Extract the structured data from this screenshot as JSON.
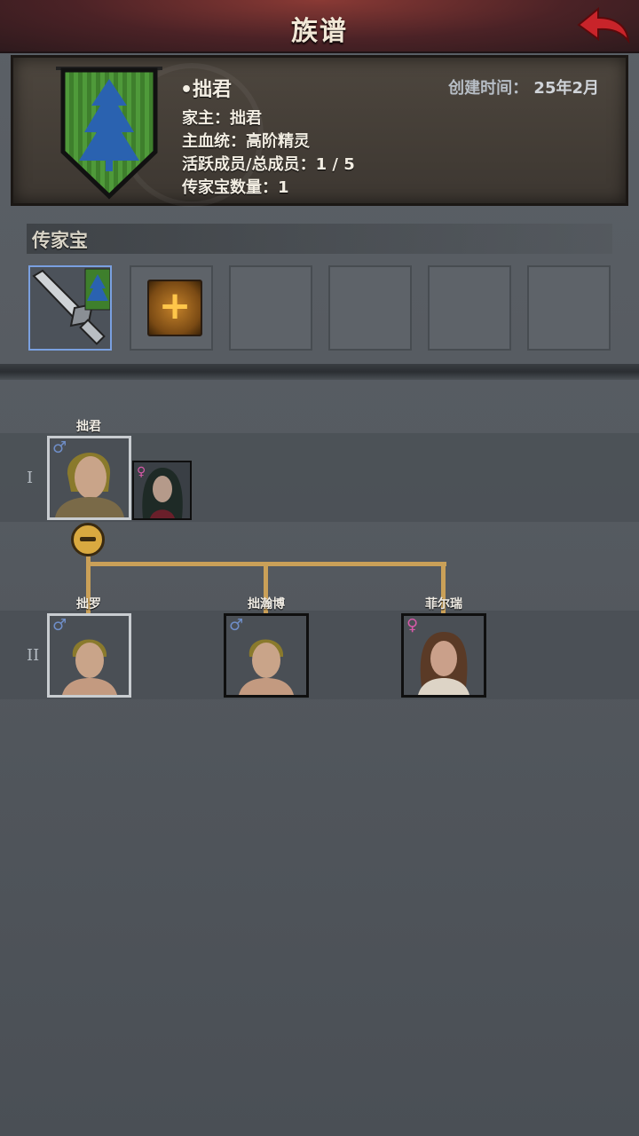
{
  "header": {
    "title": "族谱"
  },
  "clan": {
    "name": "•拙君",
    "created_label": "创建时间：",
    "created_value": "25年2月",
    "info": [
      "家主：拙君",
      "主血统：高阶精灵",
      "活跃成员/总成员：1 / 5",
      "传家宝数量：1"
    ]
  },
  "heirloom": {
    "title": "传家宝"
  },
  "tree": {
    "generations": [
      {
        "label": "I"
      },
      {
        "label": "II"
      }
    ],
    "members": [
      {
        "name": "拙君",
        "gender": "♂"
      },
      {
        "name": "拙罗",
        "gender": "♂"
      },
      {
        "name": "拙瀚博",
        "gender": "♂"
      },
      {
        "name": "菲尔瑞",
        "gender": "♀"
      }
    ],
    "spouse": {
      "gender": "♀"
    }
  }
}
